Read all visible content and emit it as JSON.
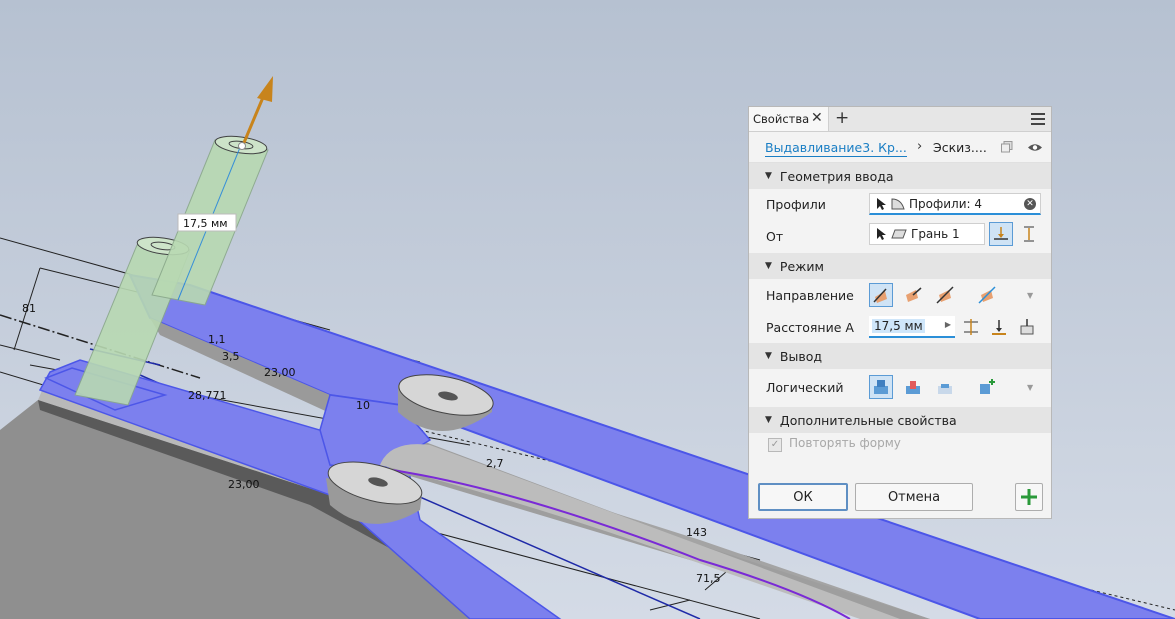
{
  "viewport": {
    "extrusion_value": "17,5 мм",
    "dimensions": [
      "81",
      "1,1",
      "3,5",
      "23,00",
      "28,771",
      "10",
      "2,7",
      "23,00",
      "143",
      "71,5"
    ]
  },
  "panel": {
    "tab_label": "Свойства",
    "breadcrumb_feature": "Выдавливание3. Кр...",
    "breadcrumb_sketch": "Эскиз....",
    "sections": {
      "input_geometry": "Геометрия ввода",
      "mode": "Режим",
      "output": "Вывод",
      "advanced": "Дополнительные свойства"
    },
    "profiles_label": "Профили",
    "profiles_value": "Профили: 4",
    "from_label": "От",
    "from_value": "Грань 1",
    "direction_label": "Направление",
    "distance_label": "Расстояние A",
    "distance_value": "17,5 мм",
    "boolean_label": "Логический",
    "repeat_shape_label": "Повторять форму",
    "repeat_shape_checked": true,
    "ok_label": "ОК",
    "cancel_label": "Отмена"
  },
  "colors": {
    "accent": "#1a7ec4",
    "profile_fill": "#7b80ee",
    "extrusion_preview": "#b8dcb4",
    "arrow": "#c8841c",
    "ok_green": "#2a9a3a"
  },
  "icons": [
    "close-icon",
    "plus-icon",
    "menu-icon",
    "chevron-right-icon",
    "copy-icon",
    "eye-icon",
    "cursor-icon",
    "profile-icon",
    "face-icon",
    "direction-icon",
    "flip-icon",
    "align-icon",
    "boolean-icon",
    "add-icon"
  ]
}
